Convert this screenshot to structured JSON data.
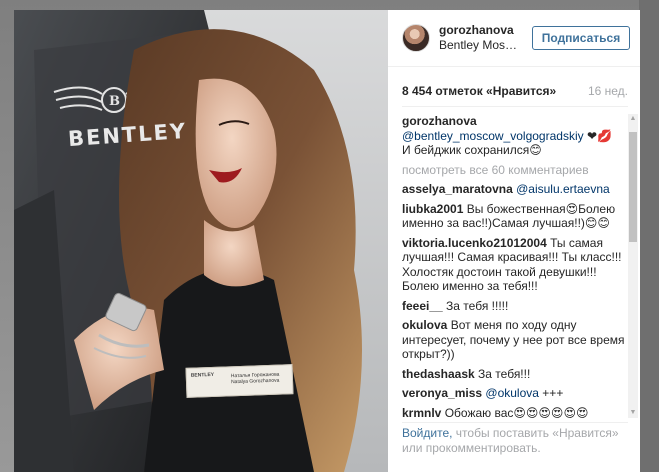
{
  "post": {
    "username": "gorozhanova",
    "location": "Bentley Mos…",
    "follow_label": "Подписаться",
    "likes": "8 454 отметок «Нравится»",
    "time": "16 нед."
  },
  "photo": {
    "brand_text": "BENTLEY",
    "badge_logo": "BENTLEY",
    "badge_name": "Наталья Горожанова Natalya Gorozhanova"
  },
  "caption": {
    "user": "gorozhanova",
    "mention": "@bentley_moscow_volgograd",
    "mention_tail": "skiy",
    "text_line1": "❤💋",
    "text_line2": "И бейджик сохранился😊"
  },
  "view_all": "посмотреть все 60 комментариев",
  "comments": [
    {
      "user": "asselya_maratovna",
      "mention": "@aisulu.ertaevna",
      "text": ""
    },
    {
      "user": "liubka2001",
      "mention": "",
      "text": "Вы божественная😍Болею именно за вас!!)Самая лучшая!!)😊😊"
    },
    {
      "user": "viktoria.lucenko21012004",
      "mention": "",
      "text": "Ты самая лучшая!!! Самая красивая!!! Ты класс!!! Холостяк достоин такой девушки!!! Болею именно за тебя!!!"
    },
    {
      "user": "feeei__",
      "mention": "",
      "text": "За тебя !!!!!"
    },
    {
      "user": "okulova",
      "mention": "",
      "text": "Вот меня по ходу одну интересует, почему у нее рот все время открыт?))"
    },
    {
      "user": "thedashaask",
      "mention": "",
      "text": "За тебя!!!"
    },
    {
      "user": "veronya_miss",
      "mention": "@okulova",
      "text": "+++"
    },
    {
      "user": "krmnlv",
      "mention": "",
      "text": "Обожаю вас😍😍😍😍😍😍"
    }
  ],
  "footer": {
    "login": "Войдите,",
    "text": " чтобы поставить «Нравится» или прокомментировать."
  },
  "colors": {
    "accent": "#3f729b",
    "mention": "#003569",
    "muted": "#a5a7aa"
  },
  "icons": {
    "scroll_up": "triangle-up",
    "scroll_down": "triangle-down"
  }
}
